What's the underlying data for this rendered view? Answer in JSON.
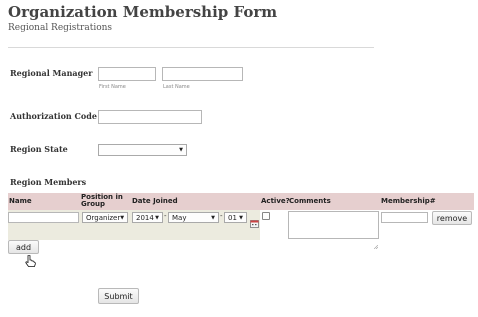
{
  "form": {
    "title": "Organization Membership Form",
    "subtitle": "Regional Registrations"
  },
  "regional_manager": {
    "label": "Regional Manager",
    "first_name_value": "",
    "first_name_sublabel": "First Name",
    "last_name_value": "",
    "last_name_sublabel": "Last Name"
  },
  "authorization": {
    "label": "Authorization Code",
    "value": ""
  },
  "region_state": {
    "label": "Region State",
    "selected": ""
  },
  "members": {
    "section_label": "Region Members",
    "columns": {
      "name": "Name",
      "position": "Position in Group",
      "date_joined": "Date Joined",
      "active": "Active?",
      "comments": "Comments",
      "membership": "Membership#"
    },
    "row": {
      "name_value": "",
      "position_value": "Organizer",
      "year_value": "2014",
      "date_sep_1": "-",
      "month_value": "May",
      "date_sep_2": "-",
      "day_value": "01",
      "active_checked": false,
      "comments_value": "",
      "membership_value": "",
      "remove_label": "remove"
    },
    "add_label": "add"
  },
  "submit_label": "Submit"
}
